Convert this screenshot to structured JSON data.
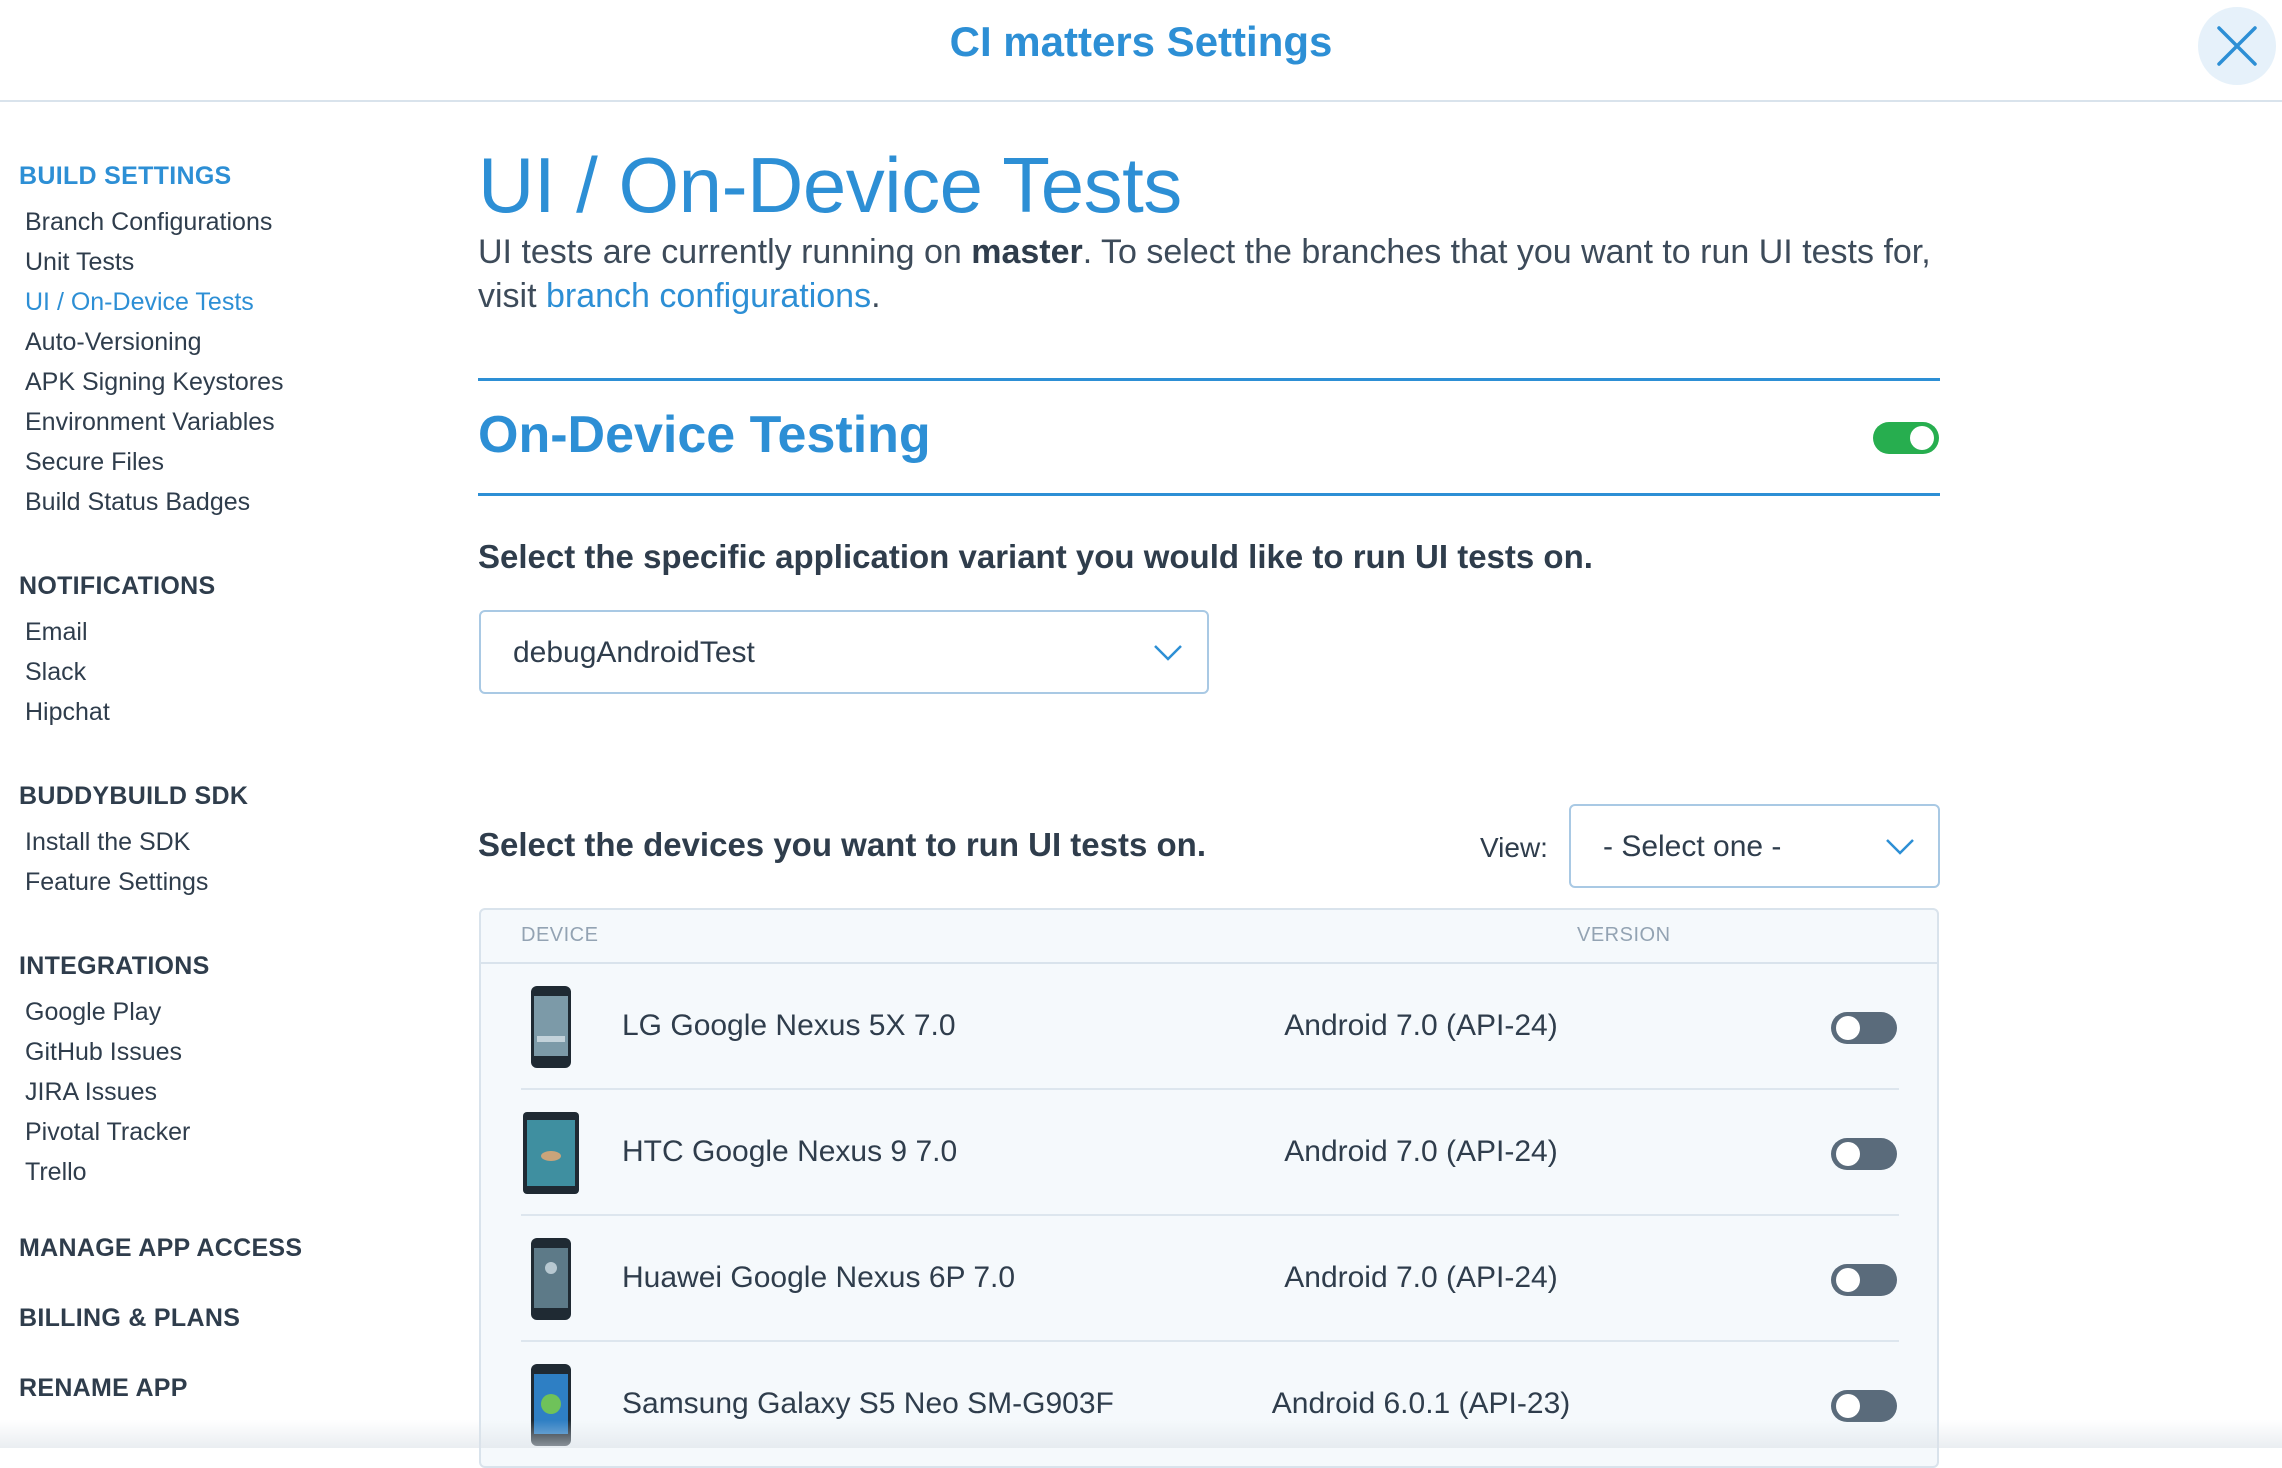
{
  "header": {
    "title": "CI matters Settings"
  },
  "colors": {
    "accent": "#2d8fd5",
    "toggle_on": "#27ae4f",
    "toggle_off": "#5a6b7b",
    "text": "#2f3d4c"
  },
  "sidebar": {
    "build_settings": {
      "heading": "BUILD SETTINGS",
      "items": [
        "Branch Configurations",
        "Unit Tests",
        "UI / On-Device Tests",
        "Auto-Versioning",
        "APK Signing Keystores",
        "Environment Variables",
        "Secure Files",
        "Build Status Badges"
      ]
    },
    "notifications": {
      "heading": "NOTIFICATIONS",
      "items": [
        "Email",
        "Slack",
        "Hipchat"
      ]
    },
    "sdk": {
      "heading": "BUDDYBUILD SDK",
      "items": [
        "Install the SDK",
        "Feature Settings"
      ]
    },
    "integrations": {
      "heading": "INTEGRATIONS",
      "items": [
        "Google Play",
        "GitHub Issues",
        "JIRA Issues",
        "Pivotal Tracker",
        "Trello"
      ]
    },
    "manage_access": "MANAGE APP ACCESS",
    "billing": "BILLING & PLANS",
    "rename": "RENAME APP"
  },
  "main": {
    "title": "UI / On-Device Tests",
    "intro_before": "UI tests are currently running on ",
    "intro_branch": "master",
    "intro_middle": ". To select the branches that you want to run UI tests for, visit ",
    "intro_link": "branch configurations",
    "intro_end": ".",
    "section_title": "On-Device Testing",
    "section_enabled": true,
    "variant_prompt": "Select the specific application variant you would like to run UI tests on.",
    "variant_value": "debugAndroidTest",
    "devices_prompt": "Select the devices you want to run UI tests on.",
    "view_label": "View:",
    "view_value": "- Select one -",
    "table": {
      "col_device": "DEVICE",
      "col_version": "VERSION",
      "rows": [
        {
          "name": "LG Google Nexus 5X 7.0",
          "version": "Android 7.0 (API-24)",
          "enabled": false,
          "icon": "phone-icon"
        },
        {
          "name": "HTC Google Nexus 9 7.0",
          "version": "Android 7.0 (API-24)",
          "enabled": false,
          "icon": "tablet-icon"
        },
        {
          "name": "Huawei Google Nexus 6P 7.0",
          "version": "Android 7.0 (API-24)",
          "enabled": false,
          "icon": "phone-icon"
        },
        {
          "name": "Samsung Galaxy S5 Neo SM-G903F",
          "version": "Android 6.0.1 (API-23)",
          "enabled": false,
          "icon": "phone-icon"
        }
      ]
    }
  }
}
